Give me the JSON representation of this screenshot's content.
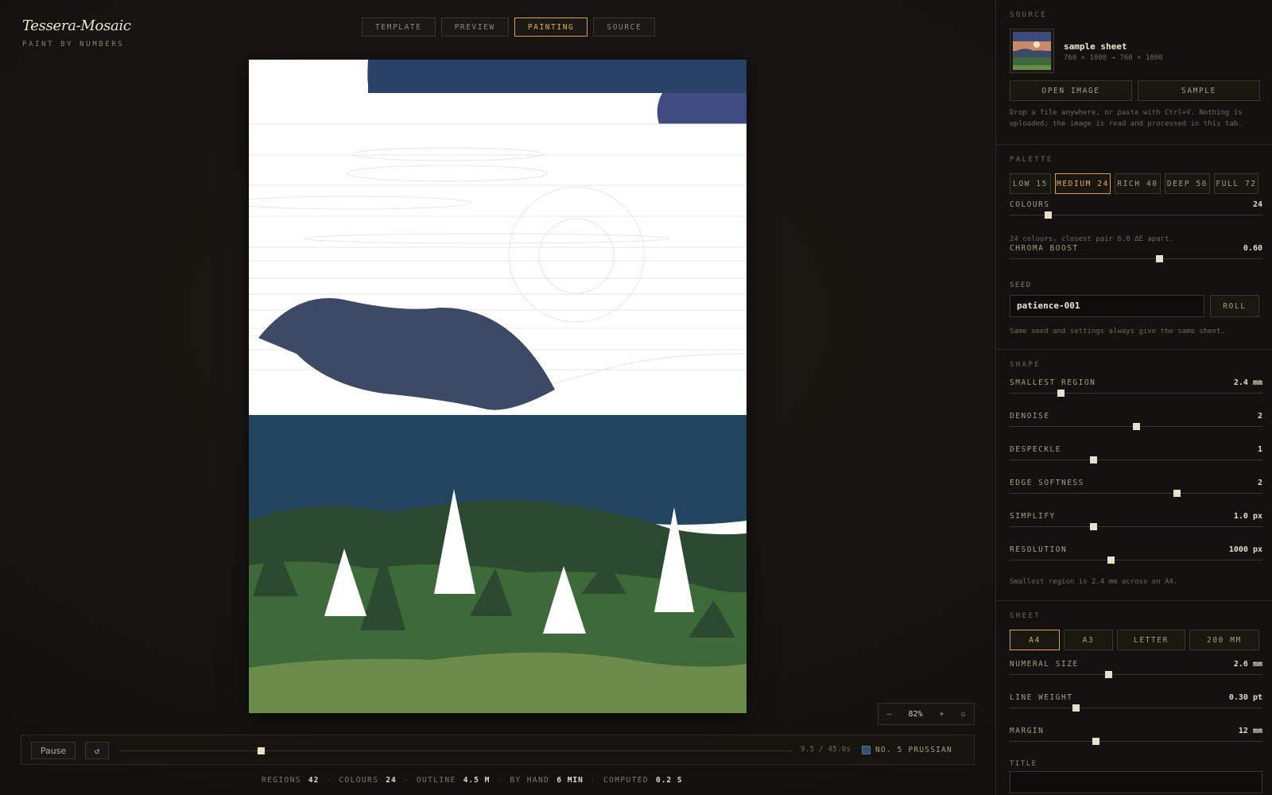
{
  "brand": {
    "title": "Tessera-Mosaic",
    "subtitle": "PAINT BY NUMBERS"
  },
  "tabs": [
    {
      "label": "TEMPLATE",
      "active": false
    },
    {
      "label": "PREVIEW",
      "active": false
    },
    {
      "label": "PAINTING",
      "active": true
    },
    {
      "label": "SOURCE",
      "active": false
    }
  ],
  "zoom": {
    "minus": "–",
    "value": "82%",
    "plus": "+",
    "fit": "▫"
  },
  "player": {
    "pause_label": "Pause",
    "reset_icon": "↺",
    "progress": 0.21,
    "time": "9.5 / 45.0s",
    "current_color_swatch": "#2b5270",
    "current_color": "NO. 5 PRUSSIAN"
  },
  "stats": [
    {
      "label": "REGIONS",
      "value": "42"
    },
    {
      "label": "COLOURS",
      "value": "24"
    },
    {
      "label": "OUTLINE",
      "value": "4.5 M"
    },
    {
      "label": "BY HAND",
      "value": "6 MIN"
    },
    {
      "label": "COMPUTED",
      "value": "0.2 S"
    }
  ],
  "stat_sep": "·",
  "source": {
    "heading": "SOURCE",
    "name": "sample sheet",
    "dims": "760 × 1000 → 760 × 1000",
    "open_label": "OPEN IMAGE",
    "sample_label": "SAMPLE",
    "note": "Drop a file anywhere, or paste with Ctrl+V. Nothing is uploaded; the image is read and processed in this tab."
  },
  "palette": {
    "heading": "PALETTE",
    "options": [
      {
        "label": "LOW 15",
        "active": false
      },
      {
        "label": "MEDIUM 24",
        "active": true
      },
      {
        "label": "RICH 40",
        "active": false
      },
      {
        "label": "DEEP 56",
        "active": false
      },
      {
        "label": "FULL 72",
        "active": false
      }
    ],
    "colours_label": "COLOURS",
    "colours_value": "24",
    "colours_level": 0.15,
    "note": "24 colours, closest pair 6.0 ΔE apart.",
    "chroma_label": "CHROMA BOOST",
    "chroma_value": "0.60",
    "chroma_level": 0.59,
    "seed_label": "SEED",
    "seed_value": "patience-001",
    "roll_label": "ROLL",
    "seed_note": "Same seed and settings always give the same sheet."
  },
  "shape": {
    "heading": "SHAPE",
    "sliders": [
      {
        "label": "SMALLEST REGION",
        "value": "2.4 mm",
        "level": 0.2
      },
      {
        "label": "DENOISE",
        "value": "2",
        "level": 0.5
      },
      {
        "label": "DESPECKLE",
        "value": "1",
        "level": 0.33
      },
      {
        "label": "EDGE SOFTNESS",
        "value": "2",
        "level": 0.66
      },
      {
        "label": "SIMPLIFY",
        "value": "1.0 px",
        "level": 0.33
      },
      {
        "label": "RESOLUTION",
        "value": "1000 px",
        "level": 0.4
      }
    ],
    "note": "Smallest region is 2.4 mm across on A4."
  },
  "sheet": {
    "heading": "SHEET",
    "sizes": [
      {
        "label": "A4",
        "active": true
      },
      {
        "label": "A3",
        "active": false
      },
      {
        "label": "LETTER",
        "active": false
      },
      {
        "label": "200 MM",
        "active": false
      }
    ],
    "sliders": [
      {
        "label": "NUMERAL SIZE",
        "value": "2.6 mm",
        "level": 0.39
      },
      {
        "label": "LINE WEIGHT",
        "value": "0.30 pt",
        "level": 0.26
      },
      {
        "label": "MARGIN",
        "value": "12 mm",
        "level": 0.34
      }
    ],
    "title_label": "TITLE",
    "title_value": ""
  },
  "colors": {
    "accent": "#e5ad55",
    "sky_navy": "#2a4268",
    "sky_blue": "#3e4c80",
    "mountain": "#3c4a66",
    "lake": "#23455f",
    "forest_dark": "#2c4a30",
    "forest_mid": "#3e6a3a",
    "meadow": "#6a8b4a"
  }
}
